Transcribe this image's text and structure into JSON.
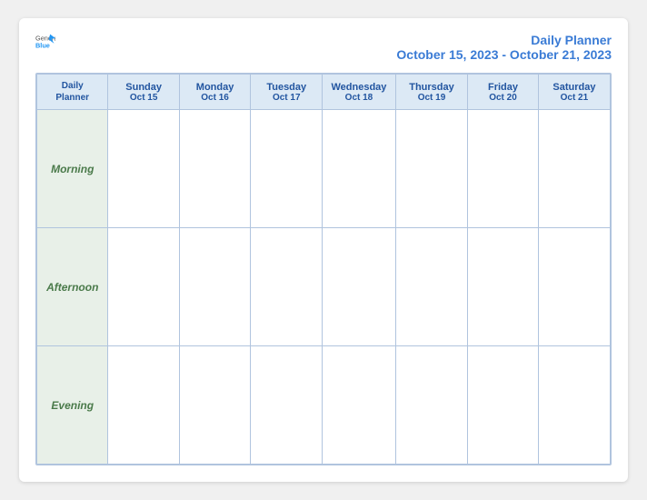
{
  "header": {
    "logo": {
      "general": "General",
      "blue": "Blue",
      "bird_label": "generalblue-logo"
    },
    "title": "Daily Planner",
    "date_range": "October 15, 2023 - October 21, 2023"
  },
  "table": {
    "label_header": {
      "line1": "Daily",
      "line2": "Planner"
    },
    "columns": [
      {
        "day": "Sunday",
        "date": "Oct 15"
      },
      {
        "day": "Monday",
        "date": "Oct 16"
      },
      {
        "day": "Tuesday",
        "date": "Oct 17"
      },
      {
        "day": "Wednesday",
        "date": "Oct 18"
      },
      {
        "day": "Thursday",
        "date": "Oct 19"
      },
      {
        "day": "Friday",
        "date": "Oct 20"
      },
      {
        "day": "Saturday",
        "date": "Oct 21"
      }
    ],
    "rows": [
      {
        "label": "Morning"
      },
      {
        "label": "Afternoon"
      },
      {
        "label": "Evening"
      }
    ]
  }
}
